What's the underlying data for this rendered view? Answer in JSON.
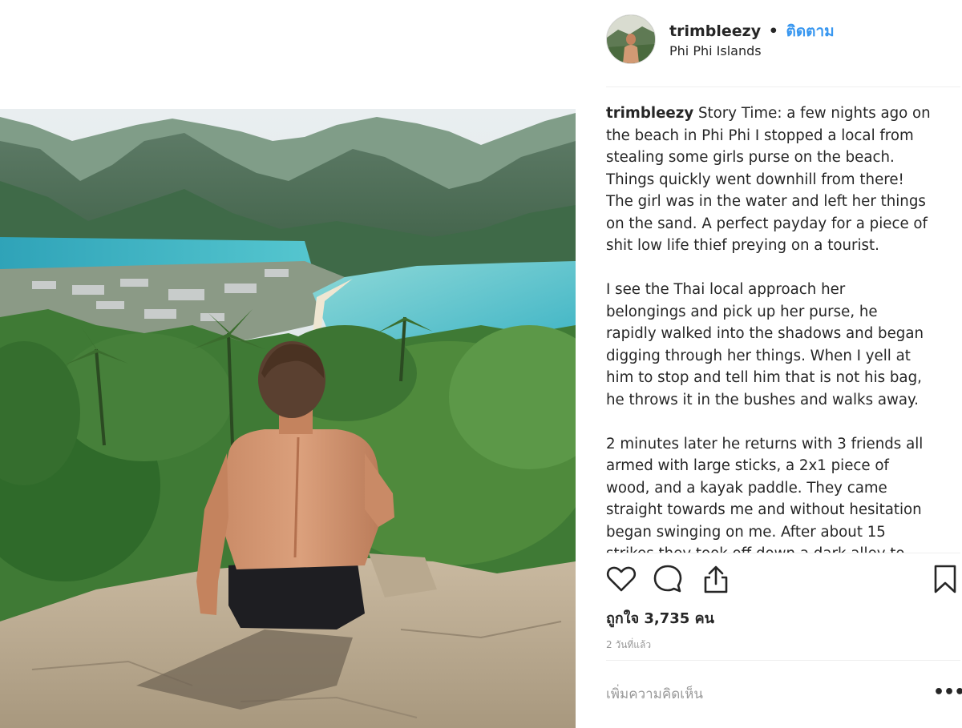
{
  "post": {
    "username": "trimbleezy",
    "separator": "•",
    "follow_label": "ติดตาม",
    "location": "Phi Phi Islands",
    "caption_username": "trimbleezy",
    "caption_lines": [
      " Story Time: a few nights ago on",
      "the beach in Phi Phi I stopped a local from",
      "stealing some girls purse on the beach.",
      "Things quickly went downhill from there!",
      "The girl was in the water and left her things",
      "on the sand. A perfect payday for a piece of",
      "shit low life thief preying on a tourist.",
      "",
      "I see the Thai local approach her",
      "belongings and pick up her purse, he",
      "rapidly walked into the shadows and began",
      "digging through her things. When I yell at",
      "him to stop and tell him that is not his bag,",
      "he throws it in the bushes and walks away.",
      "",
      "2 minutes later he returns with 3 friends all",
      "armed with large sticks, a 2x1 piece of",
      "wood, and a kayak paddle. They came",
      "straight towards me and without hesitation",
      "began swinging on me. After about 15",
      "strikes they took off down a dark alley to"
    ],
    "likes_label": "ถูกใจ 3,735 คน",
    "time_ago": "2 วันที่แล้ว",
    "comment_placeholder": "เพิ่มความคิดเห็น",
    "more_label": "•••"
  },
  "icons": {
    "like": "heart-icon",
    "comment": "comment-icon",
    "share": "share-icon",
    "save": "bookmark-icon"
  }
}
